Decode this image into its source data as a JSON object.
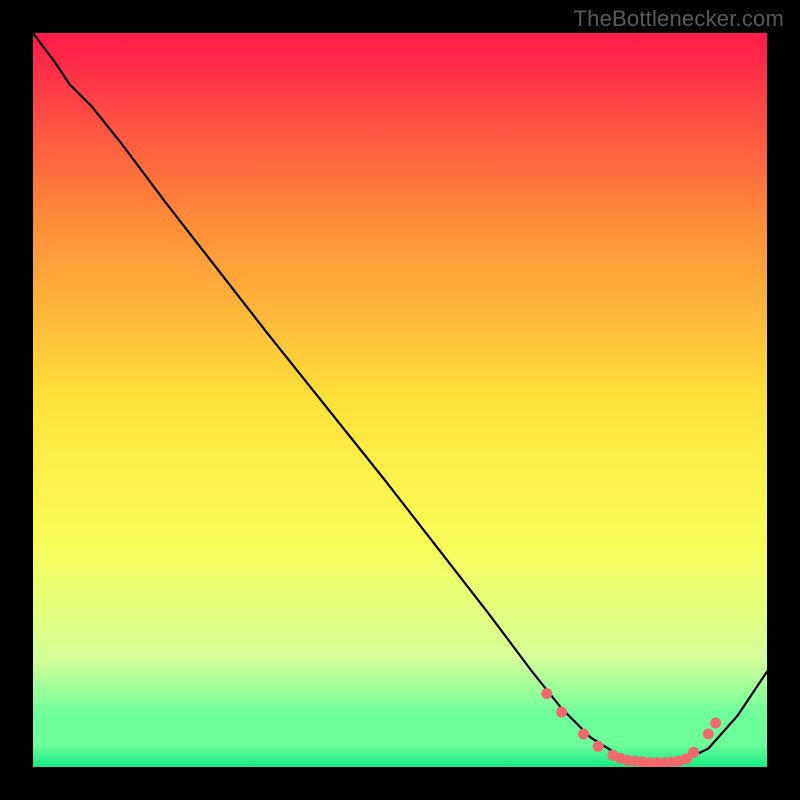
{
  "watermark": "TheBottlenecker.com",
  "chart_data": {
    "type": "line",
    "title": "",
    "xlabel": "",
    "ylabel": "",
    "xlim": [
      0,
      100
    ],
    "ylim": [
      0,
      100
    ],
    "gradient_colors": {
      "top": "#ff1a4b",
      "mid_upper": "#ff8a3a",
      "mid": "#ffe13a",
      "mid_lower": "#f8ff5a",
      "low": "#d7ff9a",
      "near_bottom": "#6cff9a",
      "bottom": "#17e884"
    },
    "series": [
      {
        "name": "curve",
        "x": [
          0,
          3,
          5,
          8,
          12,
          18,
          25,
          32,
          40,
          48,
          55,
          62,
          68,
          72,
          76,
          80,
          84,
          88,
          92,
          96,
          100
        ],
        "y": [
          100,
          96,
          93,
          90,
          85,
          77,
          68,
          59,
          49,
          39,
          30,
          21,
          13,
          8,
          4,
          1.5,
          0.6,
          0.6,
          2.5,
          7,
          13
        ]
      }
    ],
    "markers": {
      "name": "highlight-points",
      "color": "#ef6b6b",
      "r": 5.5,
      "x": [
        70,
        72,
        75,
        77,
        79,
        80,
        81,
        82,
        83,
        84,
        85,
        86,
        87,
        88,
        89,
        90,
        92,
        93
      ],
      "y": [
        10,
        7.5,
        4.5,
        2.8,
        1.6,
        1.2,
        0.9,
        0.8,
        0.7,
        0.6,
        0.6,
        0.6,
        0.7,
        0.8,
        1.1,
        2.0,
        4.5,
        6.0
      ]
    }
  }
}
